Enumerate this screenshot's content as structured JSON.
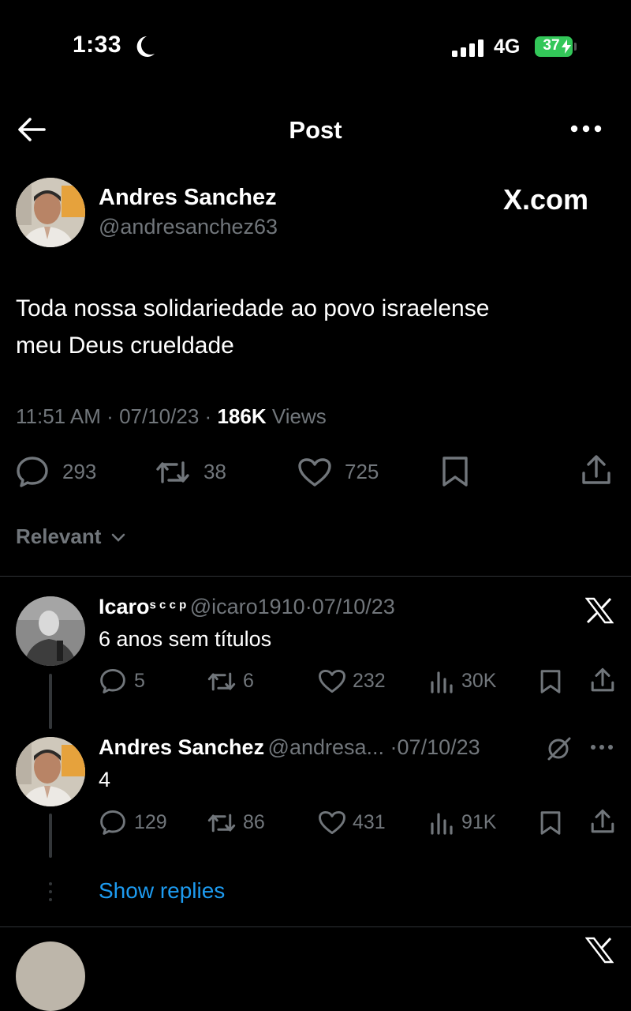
{
  "status_bar": {
    "time": "1:33",
    "network": "4G",
    "battery": "37"
  },
  "header": {
    "title": "Post"
  },
  "post": {
    "author_name": "Andres Sanchez",
    "author_handle": "@andresanchez63",
    "source_label": "X.com",
    "text_line1": "Toda nossa solidariedade ao povo israelense",
    "text_line2": "meu Deus crueldade",
    "time": "11:51 AM",
    "date": "07/10/23",
    "views_count": "186K",
    "views_label": "Views",
    "replies": "293",
    "reposts": "38",
    "likes": "725"
  },
  "sort": {
    "label": "Relevant"
  },
  "replies": [
    {
      "name": "Icaro",
      "name_suffix": "s c c p",
      "handle": "@icaro1910",
      "date": "07/10/23",
      "text": "6 anos sem títulos",
      "replies": "5",
      "reposts": "6",
      "likes": "232",
      "views": "30K"
    },
    {
      "name": "Andres Sanchez",
      "handle": "@andresa...",
      "date": "07/10/23",
      "text": "4",
      "replies": "129",
      "reposts": "86",
      "likes": "431",
      "views": "91K"
    }
  ],
  "show_replies_label": "Show replies",
  "colors": {
    "accent": "#1d9bf0",
    "muted": "#71767b",
    "battery": "#33c759"
  }
}
